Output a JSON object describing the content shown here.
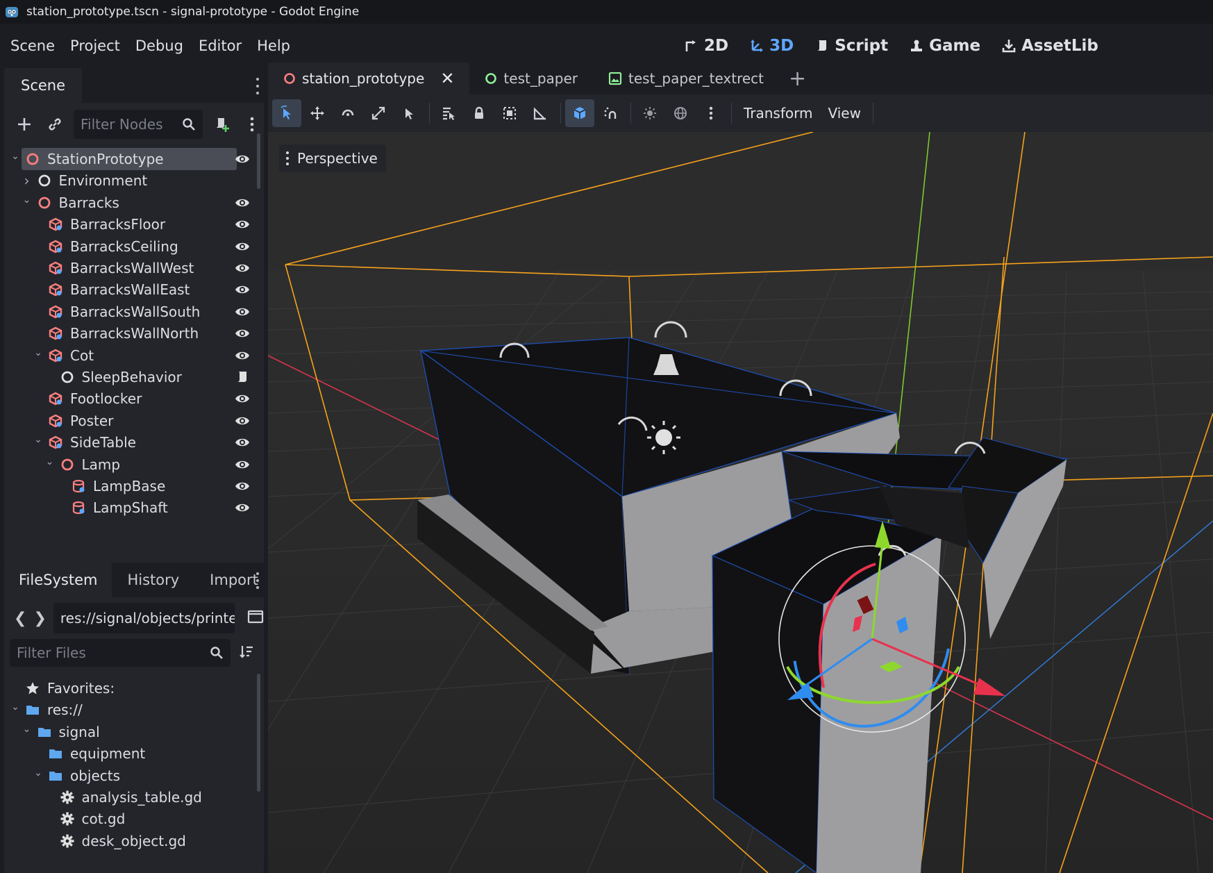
{
  "window": {
    "title": "station_prototype.tscn - signal-prototype - Godot Engine"
  },
  "menu": [
    "Scene",
    "Project",
    "Debug",
    "Editor",
    "Help"
  ],
  "main_screens": [
    {
      "label": "2D",
      "icon": "2d-icon",
      "active": false
    },
    {
      "label": "3D",
      "icon": "3d-icon",
      "active": true
    },
    {
      "label": "Script",
      "icon": "script-icon",
      "active": false
    },
    {
      "label": "Game",
      "icon": "game-icon",
      "active": false
    },
    {
      "label": "AssetLib",
      "icon": "assetlib-icon",
      "active": false
    }
  ],
  "scene_dock": {
    "tab": "Scene",
    "filter_placeholder": "Filter Nodes",
    "nodes": [
      {
        "label": "StationPrototype",
        "depth": 0,
        "icon": "node3d-icon",
        "arrow": "down",
        "eye": true,
        "selected": true
      },
      {
        "label": "Environment",
        "depth": 1,
        "icon": "node-icon",
        "arrow": "right",
        "eye": false
      },
      {
        "label": "Barracks",
        "depth": 1,
        "icon": "node3d-icon",
        "arrow": "down",
        "eye": true
      },
      {
        "label": "BarracksFloor",
        "depth": 2,
        "icon": "csg-box-icon",
        "arrow": "",
        "eye": true
      },
      {
        "label": "BarracksCeiling",
        "depth": 2,
        "icon": "csg-box-icon",
        "arrow": "",
        "eye": true
      },
      {
        "label": "BarracksWallWest",
        "depth": 2,
        "icon": "csg-box-icon",
        "arrow": "",
        "eye": true
      },
      {
        "label": "BarracksWallEast",
        "depth": 2,
        "icon": "csg-box-icon",
        "arrow": "",
        "eye": true
      },
      {
        "label": "BarracksWallSouth",
        "depth": 2,
        "icon": "csg-box-icon",
        "arrow": "",
        "eye": true
      },
      {
        "label": "BarracksWallNorth",
        "depth": 2,
        "icon": "csg-box-icon",
        "arrow": "",
        "eye": true
      },
      {
        "label": "Cot",
        "depth": 2,
        "icon": "csg-box-icon",
        "arrow": "down",
        "eye": true
      },
      {
        "label": "SleepBehavior",
        "depth": 3,
        "icon": "node-icon",
        "arrow": "",
        "eye": false,
        "script": true
      },
      {
        "label": "Footlocker",
        "depth": 2,
        "icon": "csg-box-icon",
        "arrow": "",
        "eye": true
      },
      {
        "label": "Poster",
        "depth": 2,
        "icon": "csg-box-icon",
        "arrow": "",
        "eye": true
      },
      {
        "label": "SideTable",
        "depth": 2,
        "icon": "csg-box-icon",
        "arrow": "down",
        "eye": true
      },
      {
        "label": "Lamp",
        "depth": 3,
        "icon": "node3d-icon",
        "arrow": "down",
        "eye": true
      },
      {
        "label": "LampBase",
        "depth": 4,
        "icon": "csg-cylinder-icon",
        "arrow": "",
        "eye": true
      },
      {
        "label": "LampShaft",
        "depth": 4,
        "icon": "csg-cylinder-icon",
        "arrow": "",
        "eye": true
      }
    ]
  },
  "filesystem_dock": {
    "tabs": [
      "FileSystem",
      "History",
      "Import"
    ],
    "path": "res://signal/objects/printe",
    "filter_placeholder": "Filter Files",
    "items": [
      {
        "label": "Favorites:",
        "depth": 0,
        "icon": "star-icon",
        "arrow": ""
      },
      {
        "label": "res://",
        "depth": 0,
        "icon": "folder-icon",
        "arrow": "down"
      },
      {
        "label": "signal",
        "depth": 1,
        "icon": "folder-icon",
        "arrow": "down"
      },
      {
        "label": "equipment",
        "depth": 2,
        "icon": "folder-icon",
        "arrow": ""
      },
      {
        "label": "objects",
        "depth": 2,
        "icon": "folder-icon",
        "arrow": "down"
      },
      {
        "label": "analysis_table.gd",
        "depth": 3,
        "icon": "gear-icon",
        "arrow": ""
      },
      {
        "label": "cot.gd",
        "depth": 3,
        "icon": "gear-icon",
        "arrow": ""
      },
      {
        "label": "desk_object.gd",
        "depth": 3,
        "icon": "gear-icon",
        "arrow": ""
      }
    ]
  },
  "scene_tabs": [
    {
      "label": "station_prototype",
      "icon": "node3d-icon",
      "active": true,
      "closable": true
    },
    {
      "label": "test_paper",
      "icon": "node-icon-green",
      "active": false
    },
    {
      "label": "test_paper_textrect",
      "icon": "image-icon",
      "active": false
    }
  ],
  "viewport_toolbar": {
    "transform_label": "Transform",
    "view_label": "View"
  },
  "viewport": {
    "perspective_label": "Perspective"
  },
  "colors": {
    "accent": "#5ea8ff",
    "node3d": "#fc7f7f",
    "csg": "#fc7f7f",
    "folder": "#5fa7ef",
    "green_node": "#8eef97",
    "selection_box": "#f7a21b",
    "axis_x": "#e8324d",
    "axis_y": "#8ed82d",
    "axis_z": "#2f8cf0"
  }
}
